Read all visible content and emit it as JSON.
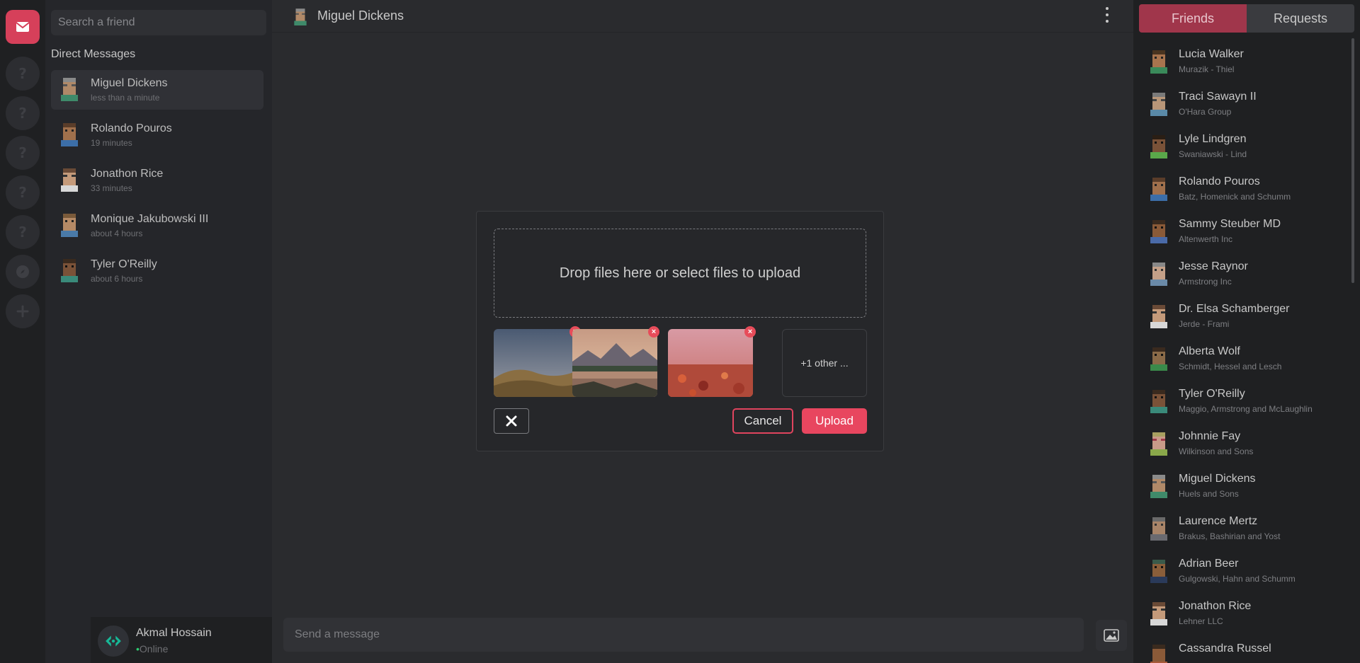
{
  "rail": {
    "items": [
      {
        "icon": "mail-icon",
        "active": true
      },
      {
        "icon": "question-icon"
      },
      {
        "icon": "question-icon"
      },
      {
        "icon": "question-icon"
      },
      {
        "icon": "question-icon"
      },
      {
        "icon": "question-icon"
      },
      {
        "icon": "compass-icon"
      },
      {
        "icon": "plus-icon"
      }
    ]
  },
  "sidebar": {
    "search_placeholder": "Search a friend",
    "heading": "Direct Messages",
    "dms": [
      {
        "name": "Miguel Dickens",
        "time": "less than a minute"
      },
      {
        "name": "Rolando Pouros",
        "time": "19 minutes"
      },
      {
        "name": "Jonathon Rice",
        "time": "33 minutes"
      },
      {
        "name": "Monique Jakubowski III",
        "time": "about 4 hours"
      },
      {
        "name": "Tyler O'Reilly",
        "time": "about 6 hours"
      }
    ],
    "user": {
      "name": "Akmal Hossain",
      "status": "Online"
    }
  },
  "chat": {
    "title": "Miguel Dickens",
    "composer_placeholder": "Send a message"
  },
  "modal": {
    "dropzone_text": "Drop files here or select files to upload",
    "more_text": "+1 other ...",
    "cancel_label": "Cancel",
    "upload_label": "Upload",
    "remove_glyph": "×"
  },
  "friends": {
    "tabs": [
      "Friends",
      "Requests"
    ],
    "list": [
      {
        "name": "Lucia Walker",
        "company": "Murazik - Thiel"
      },
      {
        "name": "Traci Sawayn II",
        "company": "O'Hara Group"
      },
      {
        "name": "Lyle Lindgren",
        "company": "Swaniawski - Lind"
      },
      {
        "name": "Rolando Pouros",
        "company": "Batz, Homenick and Schumm"
      },
      {
        "name": "Sammy Steuber MD",
        "company": "Altenwerth Inc"
      },
      {
        "name": "Jesse Raynor",
        "company": "Armstrong Inc"
      },
      {
        "name": "Dr. Elsa Schamberger",
        "company": "Jerde - Frami"
      },
      {
        "name": "Alberta Wolf",
        "company": "Schmidt, Hessel and Lesch"
      },
      {
        "name": "Tyler O'Reilly",
        "company": "Maggio, Armstrong and McLaughlin"
      },
      {
        "name": "Johnnie Fay",
        "company": "Wilkinson and Sons"
      },
      {
        "name": "Miguel Dickens",
        "company": "Huels and Sons"
      },
      {
        "name": "Laurence Mertz",
        "company": "Brakus, Bashirian and Yost"
      },
      {
        "name": "Adrian Beer",
        "company": "Gulgowski, Hahn and Schumm"
      },
      {
        "name": "Jonathon Rice",
        "company": "Lehner LLC"
      },
      {
        "name": "Cassandra Russel",
        "company": ""
      }
    ]
  },
  "colors": {
    "accent": "#e8465f",
    "tab_active": "#a0364b",
    "online": "#2ecc71"
  }
}
